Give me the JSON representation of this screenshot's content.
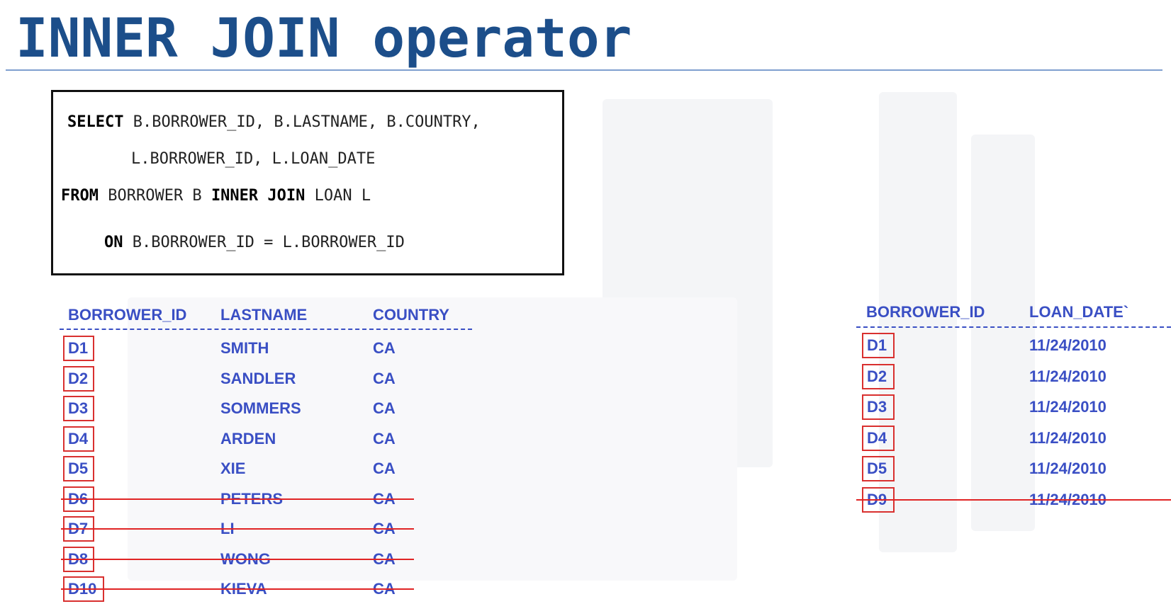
{
  "title": "INNER JOIN operator",
  "sql": {
    "line1_kw": "SELECT",
    "line1_rest": " B.BORROWER_ID, B.LASTNAME, B.COUNTRY,",
    "line2": "L.BORROWER_ID, L.LOAN_DATE",
    "line3_kw1": "FROM",
    "line3_mid": " BORROWER B ",
    "line3_kw2": "INNER JOIN",
    "line3_rest": " LOAN L",
    "line4_kw": "ON",
    "line4_rest": " B.BORROWER_ID = L.BORROWER_ID"
  },
  "borrower_table": {
    "headers": [
      "BORROWER_ID",
      "LASTNAME",
      "COUNTRY"
    ],
    "rows": [
      {
        "id": "D1",
        "lastname": "SMITH",
        "country": "CA",
        "excluded": false
      },
      {
        "id": "D2",
        "lastname": "SANDLER",
        "country": "CA",
        "excluded": false
      },
      {
        "id": "D3",
        "lastname": "SOMMERS",
        "country": "CA",
        "excluded": false
      },
      {
        "id": "D4",
        "lastname": "ARDEN",
        "country": "CA",
        "excluded": false
      },
      {
        "id": "D5",
        "lastname": "XIE",
        "country": "CA",
        "excluded": false
      },
      {
        "id": "D6",
        "lastname": "PETERS",
        "country": "CA",
        "excluded": true
      },
      {
        "id": "D7",
        "lastname": "LI",
        "country": "CA",
        "excluded": true
      },
      {
        "id": "D8",
        "lastname": "WONG",
        "country": "CA",
        "excluded": true
      },
      {
        "id": "D10",
        "lastname": "KIEVA",
        "country": "CA",
        "excluded": true
      }
    ]
  },
  "loan_table": {
    "headers": [
      "BORROWER_ID",
      "LOAN_DATE`"
    ],
    "rows": [
      {
        "id": "D1",
        "loan_date": "11/24/2010",
        "excluded": false
      },
      {
        "id": "D2",
        "loan_date": "11/24/2010",
        "excluded": false
      },
      {
        "id": "D3",
        "loan_date": "11/24/2010",
        "excluded": false
      },
      {
        "id": "D4",
        "loan_date": "11/24/2010",
        "excluded": false
      },
      {
        "id": "D5",
        "loan_date": "11/24/2010",
        "excluded": false
      },
      {
        "id": "D9",
        "loan_date": "11/24/2010",
        "excluded": true
      }
    ]
  },
  "colors": {
    "title": "#1c4e8a",
    "table_text": "#3a4fc4",
    "highlight_box": "#d9302f",
    "strike": "#e02424"
  }
}
